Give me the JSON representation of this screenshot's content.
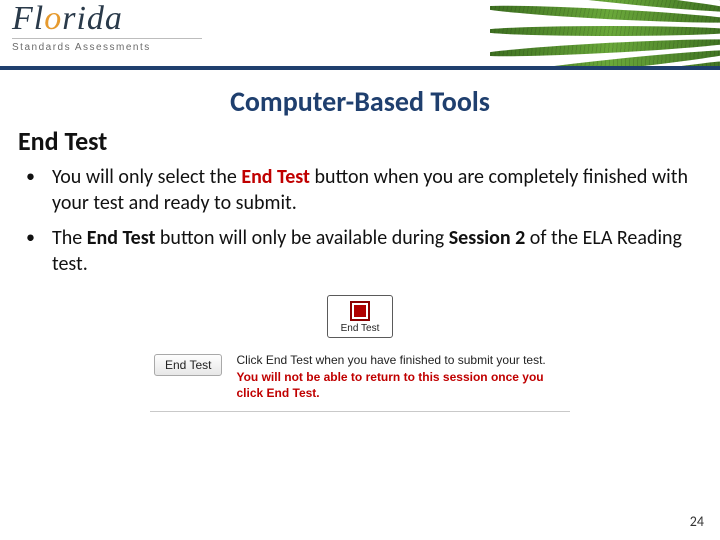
{
  "header": {
    "logo_main_pre": "Fl",
    "logo_main_orange": "o",
    "logo_main_post": "rida",
    "logo_sub": "Standards Assessments"
  },
  "title": "Computer-Based Tools",
  "section_heading": "End Test",
  "bullets": [
    {
      "pre": "You will only select the ",
      "em": "End Test",
      "em_class": "b-red",
      "post": " button when you are completely finished with your test and ready to submit."
    },
    {
      "pre": "The ",
      "em": "End Test",
      "em_class": "b",
      "mid": " button will only be available during ",
      "em2": "Session 2",
      "em2_class": "b",
      "post": " of the ELA Reading test."
    }
  ],
  "illustration": {
    "button_label": "End Test",
    "dialog_button": "End Test",
    "dialog_plain_1": "Click End Test when you have finished to submit your test. ",
    "dialog_warn": "You will not be able to return to this session once you click End Test."
  },
  "page_number": "24"
}
